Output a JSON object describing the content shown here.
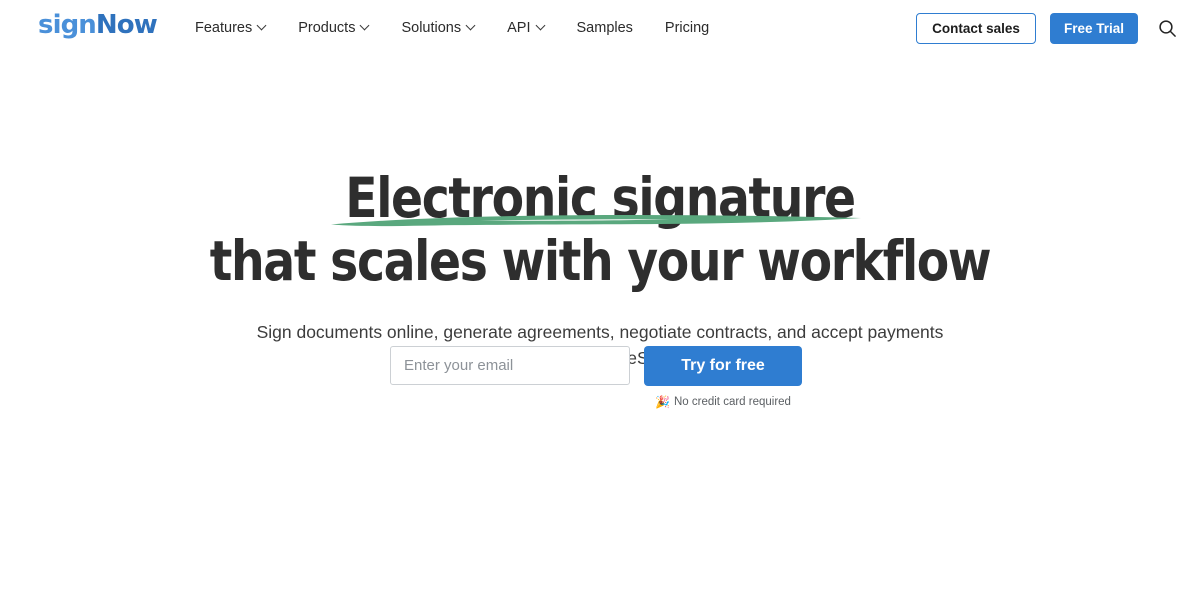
{
  "header": {
    "logo": {
      "text_light": "sign",
      "text_dark": "Now",
      "full": "signNow"
    },
    "nav": [
      {
        "label": "Features",
        "has_dropdown": true
      },
      {
        "label": "Products",
        "has_dropdown": true
      },
      {
        "label": "Solutions",
        "has_dropdown": true
      },
      {
        "label": "API",
        "has_dropdown": true
      },
      {
        "label": "Samples",
        "has_dropdown": false
      },
      {
        "label": "Pricing",
        "has_dropdown": false
      }
    ],
    "contact_sales_label": "Contact sales",
    "free_trial_label": "Free Trial",
    "search_icon": "search-icon"
  },
  "hero": {
    "headline_line1": "Electronic signature",
    "headline_line2": "that scales with your workflow",
    "subheadline": "Sign documents online, generate agreements, negotiate contracts, and accept payments with legally-binding eSignatures.",
    "brush_underline": "green-brush-stroke"
  },
  "form": {
    "email_placeholder": "Enter your email",
    "email_value": "",
    "submit_label": "Try for free",
    "disclaimer_emoji": "🎉",
    "disclaimer_text": "No credit card required"
  },
  "colors": {
    "brand_blue": "#2f7dd1",
    "logo_blue": "#3f82c8",
    "brush_green": "#5aa87e",
    "headline_dark": "#2e2e2e",
    "body_text": "#3c3c3c",
    "input_border": "#ccd0d4",
    "page_background": "#ffffff"
  }
}
